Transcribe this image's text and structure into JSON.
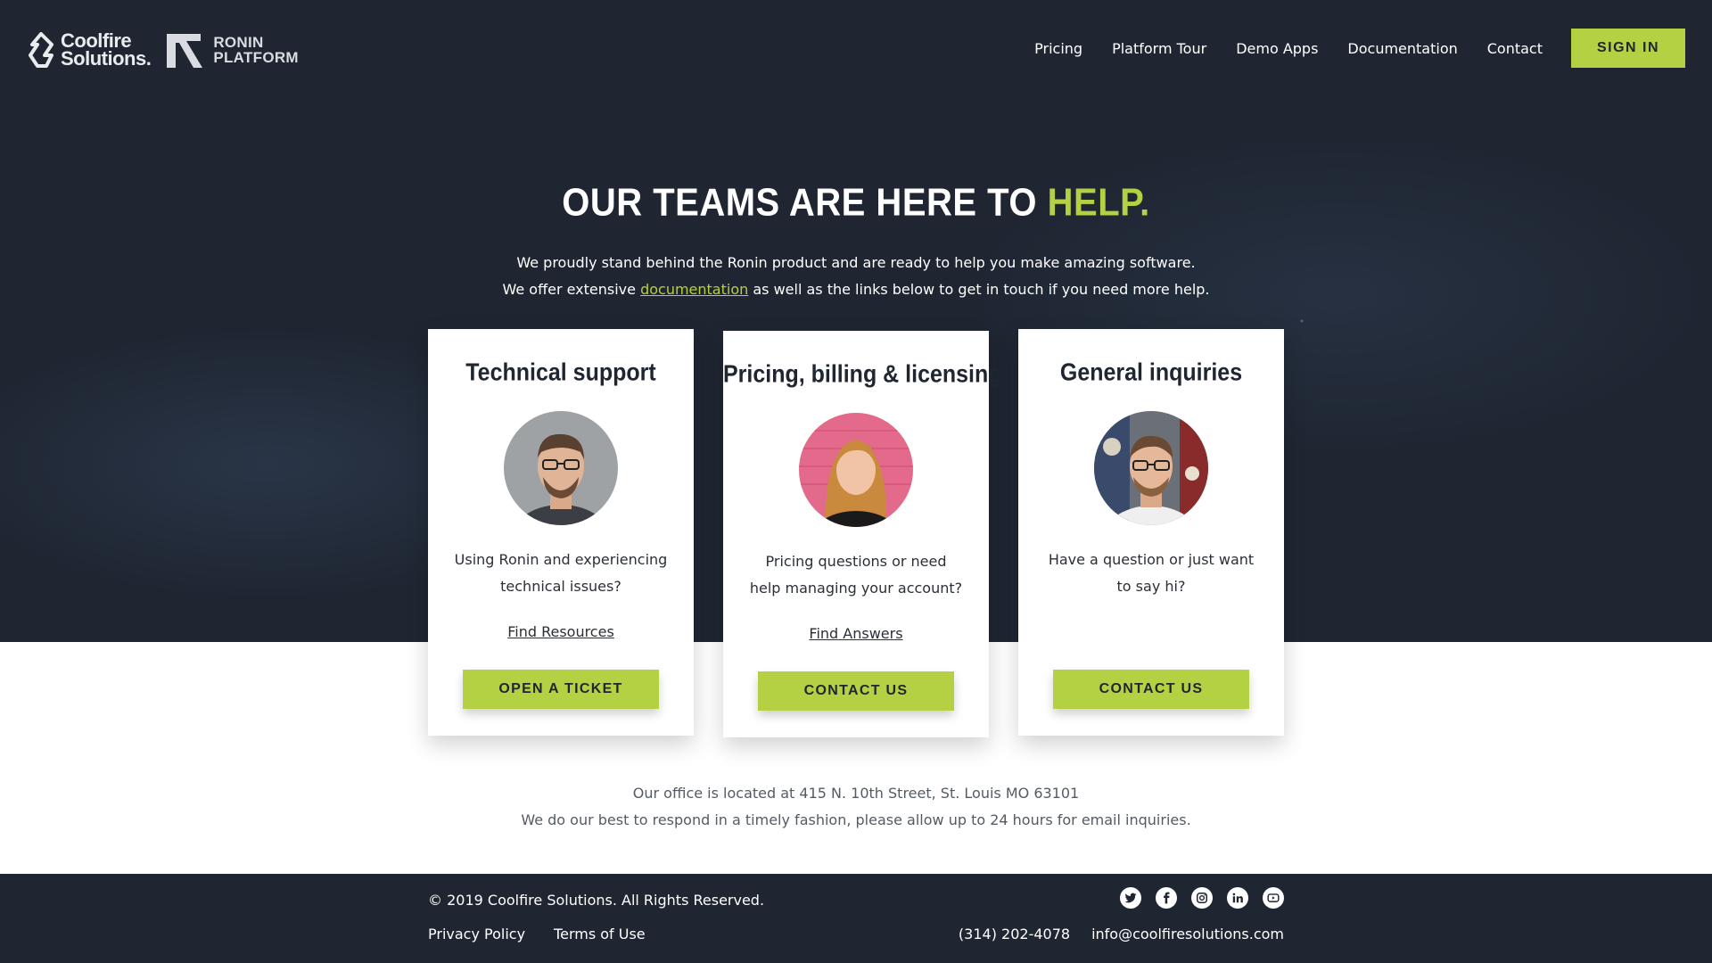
{
  "header": {
    "logo_coolfire": "Coolfire Solutions",
    "logo_coolfire_line1": "Coolfire",
    "logo_coolfire_line2": "Solutions.",
    "logo_ronin_line1": "RONIN",
    "logo_ronin_line2": "PLATFORM",
    "nav": [
      "Pricing",
      "Platform Tour",
      "Demo Apps",
      "Documentation",
      "Contact"
    ],
    "signin_label": "SIGN IN"
  },
  "hero": {
    "headline_main": "OUR TEAMS ARE HERE TO ",
    "headline_accent": "HELP.",
    "intro_line1": "We proudly stand behind the Ronin product and are ready to help you make amazing software.",
    "intro_line2_before": "We offer extensive ",
    "intro_link": "documentation",
    "intro_line2_after": " as well as the links below to get in touch if you need more help."
  },
  "cards": [
    {
      "title": "Technical support",
      "description": "Using Ronin and experiencing technical issues?",
      "link": "Find Resources",
      "button": "OPEN A TICKET"
    },
    {
      "title": "Pricing, billing & licensing",
      "description": "Pricing questions or need help managing your account?",
      "link": "Find Answers",
      "button": "CONTACT US"
    },
    {
      "title": "General inquiries",
      "description": "Have a question or just want to say hi?",
      "link": "",
      "button": "CONTACT US"
    }
  ],
  "office": {
    "line1": "Our office is located at 415 N. 10th Street, St. Louis MO 63101",
    "line2": "We do our best to respond in a timely fashion, please allow up to 24 hours for email inquiries."
  },
  "footer": {
    "copyright": "© 2019 Coolfire Solutions. All Rights Reserved.",
    "privacy": "Privacy Policy",
    "terms": "Terms of Use",
    "phone": "(314) 202-4078",
    "email": "info@coolfiresolutions.com",
    "social_icons": [
      "twitter-icon",
      "facebook-icon",
      "instagram-icon",
      "linkedin-icon",
      "youtube-icon"
    ]
  },
  "colors": {
    "accent": "#b4d043",
    "dark_bg": "#1f2632"
  }
}
